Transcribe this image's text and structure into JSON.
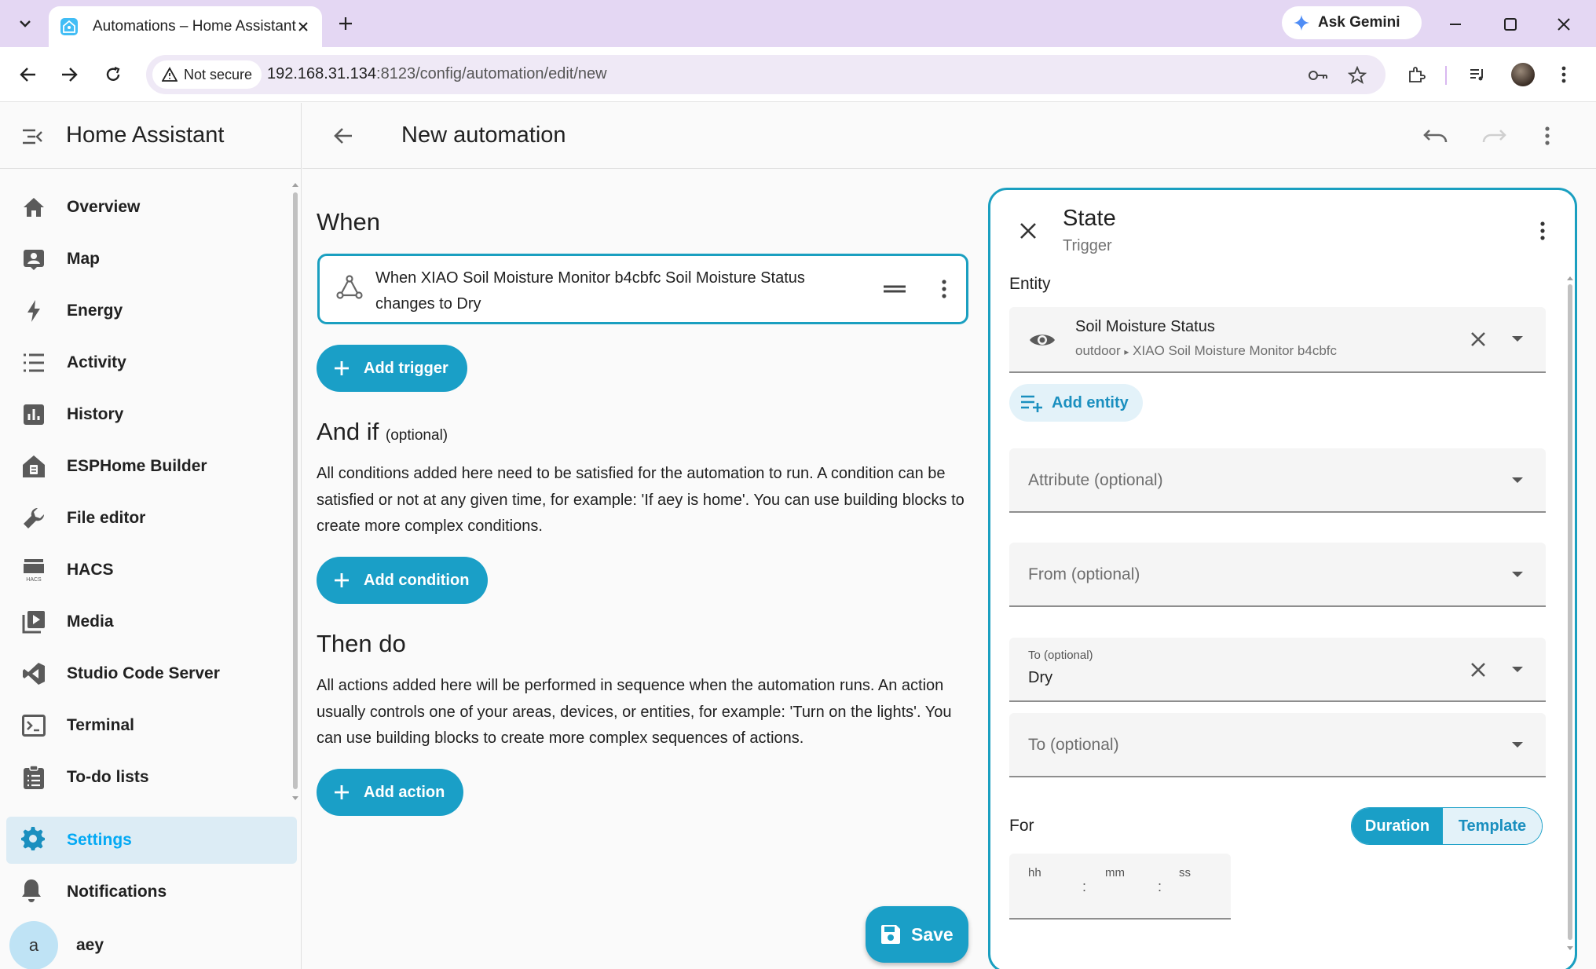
{
  "browser": {
    "tab_title": "Automations – Home Assistant",
    "gemini_label": "Ask Gemini",
    "security_label": "Not secure",
    "url_host": "192.168.31.134",
    "url_rest": ":8123/config/automation/edit/new",
    "tab_bar_color": "#e4d7f3"
  },
  "sidebar": {
    "title": "Home Assistant",
    "items": [
      {
        "label": "Overview",
        "icon": "home-icon"
      },
      {
        "label": "Map",
        "icon": "map-account-icon"
      },
      {
        "label": "Energy",
        "icon": "lightning-bolt-icon"
      },
      {
        "label": "Activity",
        "icon": "format-list-icon"
      },
      {
        "label": "History",
        "icon": "chart-box-icon"
      },
      {
        "label": "ESPHome Builder",
        "icon": "esphome-icon"
      },
      {
        "label": "File editor",
        "icon": "wrench-icon"
      },
      {
        "label": "HACS",
        "icon": "hacs-icon"
      },
      {
        "label": "Media",
        "icon": "play-box-multiple-icon"
      },
      {
        "label": "Studio Code Server",
        "icon": "vscode-icon"
      },
      {
        "label": "Terminal",
        "icon": "console-icon"
      },
      {
        "label": "To-do lists",
        "icon": "clipboard-list-icon"
      }
    ],
    "settings_label": "Settings",
    "notifications_label": "Notifications",
    "user_initial": "a",
    "user_name": "aey",
    "accent": "#03a9f4"
  },
  "header": {
    "title": "New automation"
  },
  "editor": {
    "when_heading": "When",
    "trigger_text": "When XIAO Soil Moisture Monitor b4cbfc Soil Moisture Status changes to Dry",
    "add_trigger": "Add trigger",
    "andif_heading": "And if",
    "andif_optional": "(optional)",
    "conditions_help": "All conditions added here need to be satisfied for the automation to run. A condition can be satisfied or not at any given time, for example: 'If aey is home'. You can use building blocks to create more complex conditions.",
    "add_condition": "Add condition",
    "then_heading": "Then do",
    "actions_help": "All actions added here will be performed in sequence when the automation runs. An action usually controls one of your areas, devices, or entities, for example: 'Turn on the lights'. You can use building blocks to create more complex sequences of actions.",
    "add_action": "Add action",
    "save_label": "Save",
    "primary_color": "#1a9fc7"
  },
  "panel": {
    "title": "State",
    "subtitle": "Trigger",
    "entity_label": "Entity",
    "entity_name": "Soil Moisture Status",
    "entity_area": "outdoor",
    "entity_device": "XIAO Soil Moisture Monitor b4cbfc",
    "add_entity": "Add entity",
    "attribute_placeholder": "Attribute (optional)",
    "from_placeholder": "From (optional)",
    "to_label": "To (optional)",
    "to_value": "Dry",
    "to_placeholder": "To (optional)",
    "for_label": "For",
    "duration_label": "Duration",
    "template_label": "Template",
    "hh": "hh",
    "mm": "mm",
    "ss": "ss"
  }
}
